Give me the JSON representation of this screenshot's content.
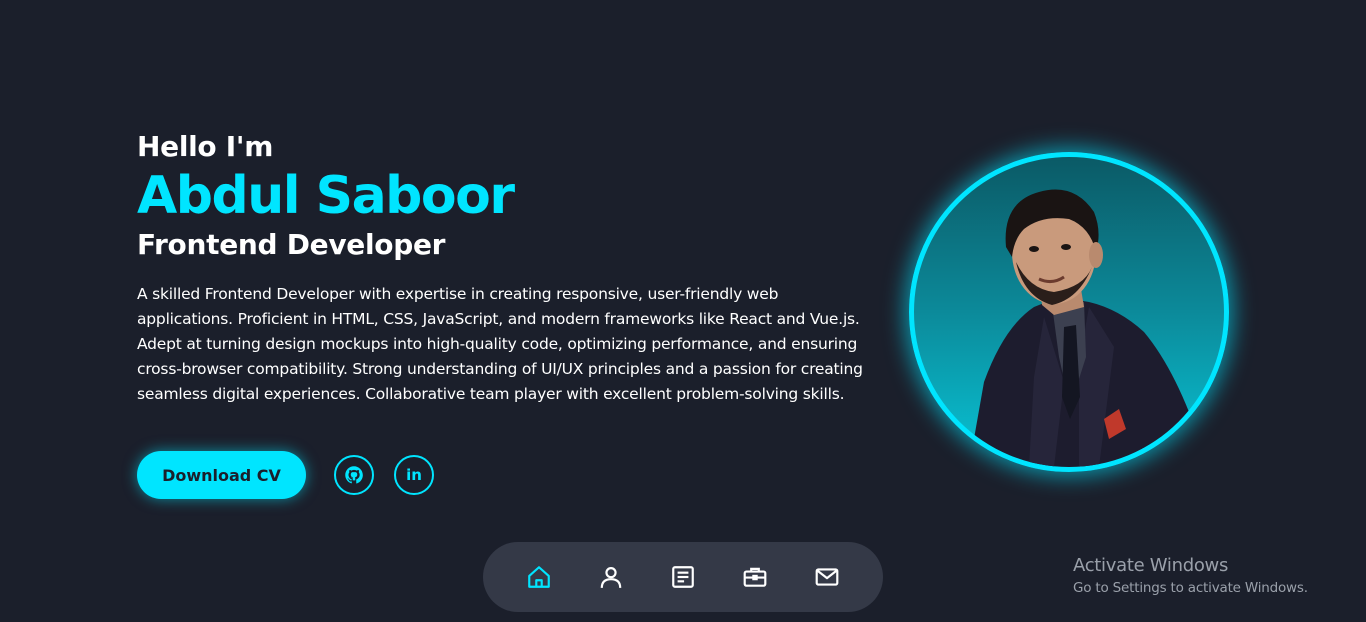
{
  "hero": {
    "greeting": "Hello I'm",
    "name": "Abdul Saboor",
    "role": "Frontend Developer",
    "bio": "A skilled Frontend Developer with expertise in creating responsive, user-friendly web applications. Proficient in HTML, CSS, JavaScript, and modern frameworks like React and Vue.js. Adept at turning design mockups into high-quality code, optimizing performance, and ensuring cross-browser compatibility. Strong understanding of UI/UX principles and a passion for creating seamless digital experiences. Collaborative team player with excellent problem-solving skills."
  },
  "actions": {
    "download_cv": "Download CV",
    "social": [
      {
        "icon": "github-icon"
      },
      {
        "icon": "linkedin-icon",
        "text": "in"
      }
    ]
  },
  "nav": {
    "items": [
      {
        "icon": "home-icon",
        "active": true
      },
      {
        "icon": "user-icon",
        "active": false
      },
      {
        "icon": "document-icon",
        "active": false
      },
      {
        "icon": "briefcase-icon",
        "active": false
      },
      {
        "icon": "mail-icon",
        "active": false
      }
    ]
  },
  "watermark": {
    "title": "Activate Windows",
    "subtitle": "Go to Settings to activate Windows."
  },
  "colors": {
    "background": "#1b1f2b",
    "accent": "#00e5ff",
    "navbar": "#343947",
    "text": "#ffffff"
  }
}
